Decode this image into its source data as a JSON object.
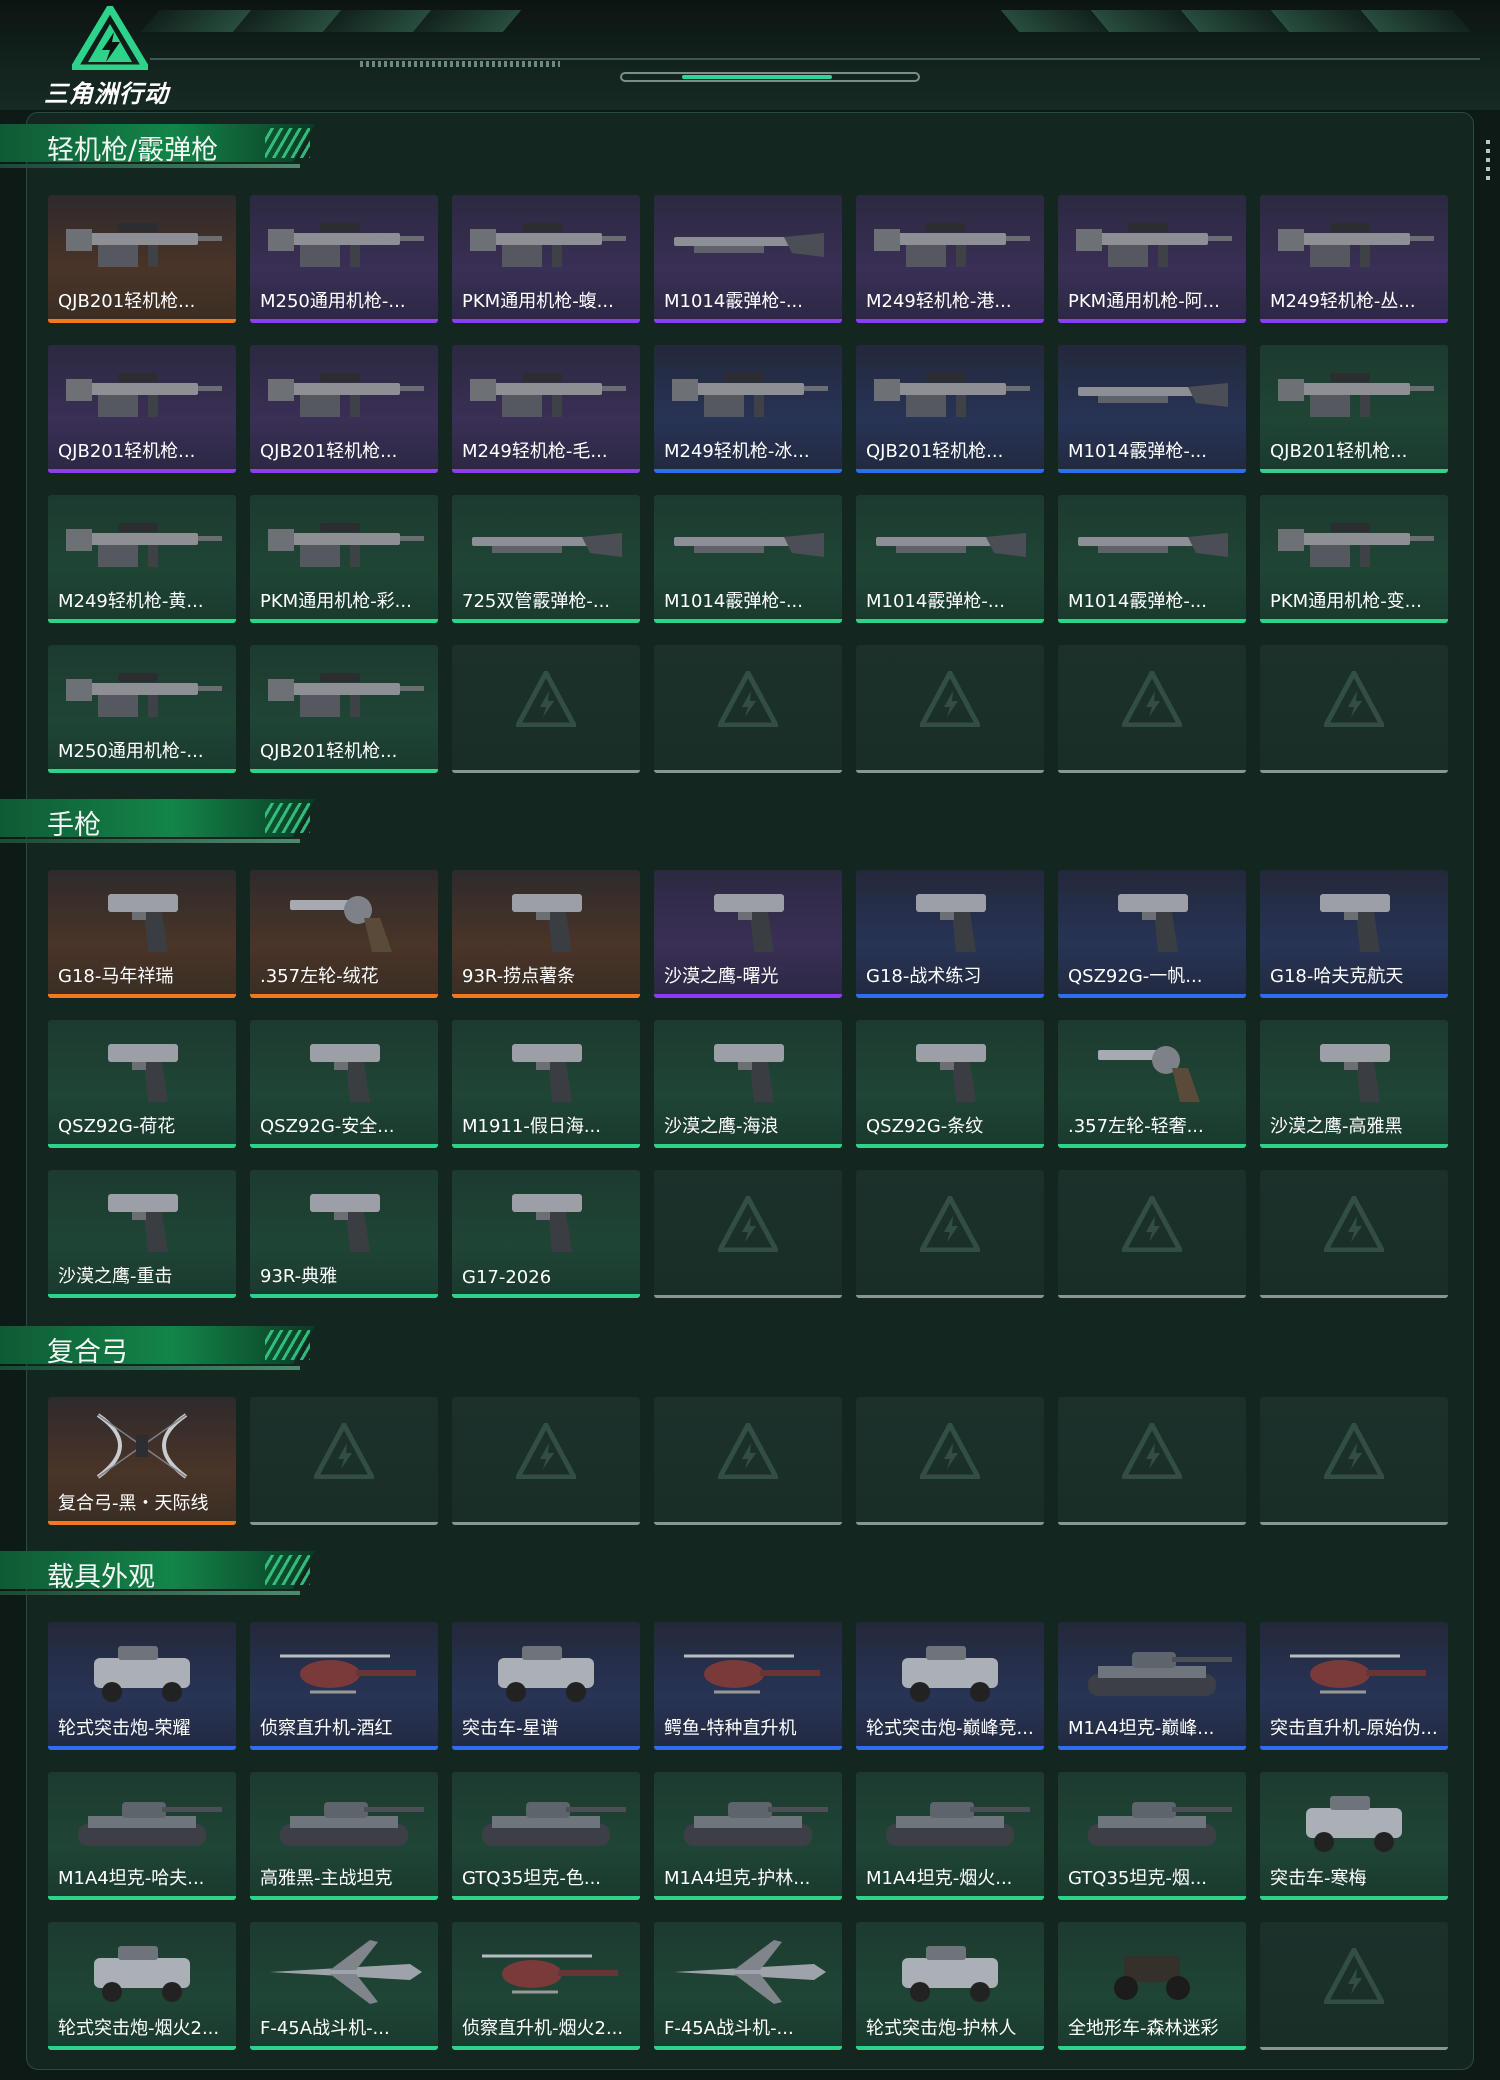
{
  "app": {
    "logo_text": "三角洲行动",
    "accent_color": "#2dd38a"
  },
  "rarity_colors": {
    "orange": "#f07a22",
    "purple": "#8a3ef0",
    "blue": "#2f6cf0",
    "green": "#2dd38a",
    "empty": "#8a9692"
  },
  "sections": [
    {
      "title": "轻机枪/霰弹枪",
      "items": [
        {
          "label": "QJB201轻机枪...",
          "rarity": "orange",
          "icon": "rifle-icon"
        },
        {
          "label": "M250通用机枪-...",
          "rarity": "purple",
          "icon": "rifle-icon"
        },
        {
          "label": "PKM通用机枪-蝮...",
          "rarity": "purple",
          "icon": "rifle-icon"
        },
        {
          "label": "M1014霰弹枪-...",
          "rarity": "purple",
          "icon": "shotgun-icon"
        },
        {
          "label": "M249轻机枪-港...",
          "rarity": "purple",
          "icon": "rifle-icon"
        },
        {
          "label": "PKM通用机枪-阿...",
          "rarity": "purple",
          "icon": "rifle-icon"
        },
        {
          "label": "M249轻机枪-丛...",
          "rarity": "purple",
          "icon": "rifle-icon"
        },
        {
          "label": "QJB201轻机枪...",
          "rarity": "purple",
          "icon": "rifle-icon"
        },
        {
          "label": "QJB201轻机枪...",
          "rarity": "purple",
          "icon": "rifle-icon"
        },
        {
          "label": "M249轻机枪-毛...",
          "rarity": "purple",
          "icon": "rifle-icon"
        },
        {
          "label": "M249轻机枪-冰...",
          "rarity": "blue",
          "icon": "rifle-icon"
        },
        {
          "label": "QJB201轻机枪...",
          "rarity": "blue",
          "icon": "rifle-icon"
        },
        {
          "label": "M1014霰弹枪-...",
          "rarity": "blue",
          "icon": "shotgun-icon"
        },
        {
          "label": "QJB201轻机枪...",
          "rarity": "green",
          "icon": "rifle-icon"
        },
        {
          "label": "M249轻机枪-黄...",
          "rarity": "green",
          "icon": "rifle-icon"
        },
        {
          "label": "PKM通用机枪-彩...",
          "rarity": "green",
          "icon": "rifle-icon"
        },
        {
          "label": "725双管霰弹枪-...",
          "rarity": "green",
          "icon": "shotgun-icon"
        },
        {
          "label": "M1014霰弹枪-...",
          "rarity": "green",
          "icon": "shotgun-icon"
        },
        {
          "label": "M1014霰弹枪-...",
          "rarity": "green",
          "icon": "shotgun-icon"
        },
        {
          "label": "M1014霰弹枪-...",
          "rarity": "green",
          "icon": "shotgun-icon"
        },
        {
          "label": "PKM通用机枪-变...",
          "rarity": "green",
          "icon": "rifle-icon"
        },
        {
          "label": "M250通用机枪-...",
          "rarity": "green",
          "icon": "rifle-icon"
        },
        {
          "label": "QJB201轻机枪...",
          "rarity": "green",
          "icon": "rifle-icon"
        },
        {
          "label": "",
          "rarity": "empty"
        },
        {
          "label": "",
          "rarity": "empty"
        },
        {
          "label": "",
          "rarity": "empty"
        },
        {
          "label": "",
          "rarity": "empty"
        },
        {
          "label": "",
          "rarity": "empty"
        }
      ]
    },
    {
      "title": "手枪",
      "items": [
        {
          "label": "G18-马年祥瑞",
          "rarity": "orange",
          "icon": "pistol-icon"
        },
        {
          "label": ".357左轮-绒花",
          "rarity": "orange",
          "icon": "revolver-icon"
        },
        {
          "label": "93R-捞点薯条",
          "rarity": "orange",
          "icon": "pistol-icon"
        },
        {
          "label": "沙漠之鹰-曙光",
          "rarity": "purple",
          "icon": "pistol-icon"
        },
        {
          "label": "G18-战术练习",
          "rarity": "blue",
          "icon": "pistol-icon"
        },
        {
          "label": "QSZ92G-一帆...",
          "rarity": "blue",
          "icon": "pistol-icon"
        },
        {
          "label": "G18-哈夫克航天",
          "rarity": "blue",
          "icon": "pistol-icon"
        },
        {
          "label": "QSZ92G-荷花",
          "rarity": "green",
          "icon": "pistol-icon"
        },
        {
          "label": "QSZ92G-安全...",
          "rarity": "green",
          "icon": "pistol-icon"
        },
        {
          "label": "M1911-假日海...",
          "rarity": "green",
          "icon": "pistol-icon"
        },
        {
          "label": "沙漠之鹰-海浪",
          "rarity": "green",
          "icon": "pistol-icon"
        },
        {
          "label": "QSZ92G-条纹",
          "rarity": "green",
          "icon": "pistol-icon"
        },
        {
          "label": ".357左轮-轻奢...",
          "rarity": "green",
          "icon": "revolver-icon"
        },
        {
          "label": "沙漠之鹰-高雅黑",
          "rarity": "green",
          "icon": "pistol-icon"
        },
        {
          "label": "沙漠之鹰-重击",
          "rarity": "green",
          "icon": "pistol-icon"
        },
        {
          "label": "93R-典雅",
          "rarity": "green",
          "icon": "pistol-icon"
        },
        {
          "label": "G17-2026",
          "rarity": "green",
          "icon": "pistol-icon"
        },
        {
          "label": "",
          "rarity": "empty"
        },
        {
          "label": "",
          "rarity": "empty"
        },
        {
          "label": "",
          "rarity": "empty"
        },
        {
          "label": "",
          "rarity": "empty"
        }
      ]
    },
    {
      "title": "复合弓",
      "items": [
        {
          "label": "复合弓-黑・天际线",
          "rarity": "orange",
          "icon": "bow-icon"
        },
        {
          "label": "",
          "rarity": "empty"
        },
        {
          "label": "",
          "rarity": "empty"
        },
        {
          "label": "",
          "rarity": "empty"
        },
        {
          "label": "",
          "rarity": "empty"
        },
        {
          "label": "",
          "rarity": "empty"
        },
        {
          "label": "",
          "rarity": "empty"
        }
      ]
    },
    {
      "title": "载具外观",
      "items": [
        {
          "label": "轮式突击炮-荣耀",
          "rarity": "blue",
          "icon": "armored-car-icon"
        },
        {
          "label": "侦察直升机-酒红",
          "rarity": "blue",
          "icon": "helicopter-icon"
        },
        {
          "label": "突击车-星谱",
          "rarity": "blue",
          "icon": "armored-car-icon"
        },
        {
          "label": "鳄鱼-特种直升机",
          "rarity": "blue",
          "icon": "helicopter-icon"
        },
        {
          "label": "轮式突击炮-巅峰竞...",
          "rarity": "blue",
          "icon": "armored-car-icon"
        },
        {
          "label": "M1A4坦克-巅峰...",
          "rarity": "blue",
          "icon": "tank-icon"
        },
        {
          "label": "突击直升机-原始伪...",
          "rarity": "blue",
          "icon": "helicopter-icon"
        },
        {
          "label": "M1A4坦克-哈夫...",
          "rarity": "green",
          "icon": "tank-icon"
        },
        {
          "label": "高雅黑-主战坦克",
          "rarity": "green",
          "icon": "tank-icon"
        },
        {
          "label": "GTQ35坦克-色...",
          "rarity": "green",
          "icon": "tank-icon"
        },
        {
          "label": "M1A4坦克-护林...",
          "rarity": "green",
          "icon": "tank-icon"
        },
        {
          "label": "M1A4坦克-烟火...",
          "rarity": "green",
          "icon": "tank-icon"
        },
        {
          "label": "GTQ35坦克-烟...",
          "rarity": "green",
          "icon": "tank-icon"
        },
        {
          "label": "突击车-寒梅",
          "rarity": "green",
          "icon": "armored-car-icon"
        },
        {
          "label": "轮式突击炮-烟火2...",
          "rarity": "green",
          "icon": "armored-car-icon"
        },
        {
          "label": "F-45A战斗机-...",
          "rarity": "green",
          "icon": "jet-icon"
        },
        {
          "label": "侦察直升机-烟火2...",
          "rarity": "green",
          "icon": "helicopter-icon"
        },
        {
          "label": "F-45A战斗机-...",
          "rarity": "green",
          "icon": "jet-icon"
        },
        {
          "label": "轮式突击炮-护林人",
          "rarity": "green",
          "icon": "armored-car-icon"
        },
        {
          "label": "全地形车-森林迷彩",
          "rarity": "green",
          "icon": "atv-icon"
        },
        {
          "label": "",
          "rarity": "empty"
        }
      ]
    }
  ]
}
